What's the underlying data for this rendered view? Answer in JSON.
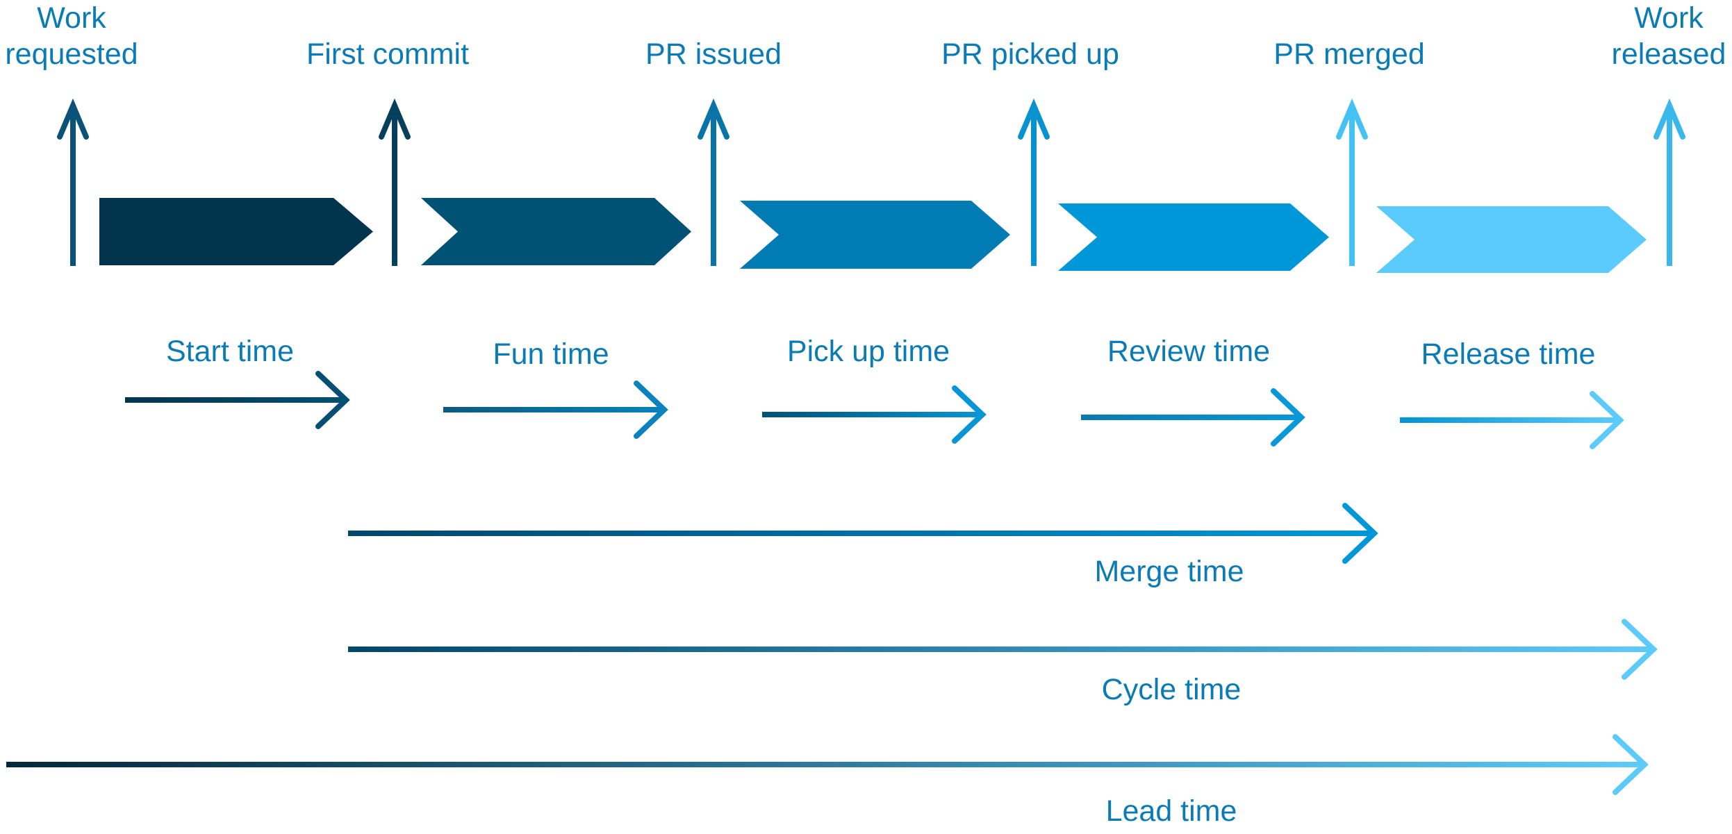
{
  "milestones": [
    {
      "label_lines": [
        "Work",
        "requested"
      ],
      "color": "#0a5277"
    },
    {
      "label_lines": [
        "First commit"
      ],
      "color": "#063f5c"
    },
    {
      "label_lines": [
        "PR issued"
      ],
      "color": "#0a73a8"
    },
    {
      "label_lines": [
        "PR picked up"
      ],
      "color": "#0892d0"
    },
    {
      "label_lines": [
        "PR merged"
      ],
      "color": "#45c2f5"
    },
    {
      "label_lines": [
        "Work",
        "released"
      ],
      "color": "#3ab8ec"
    }
  ],
  "phases": [
    {
      "label": "Start time",
      "color": "#02344e",
      "arrow_from": "#02344e",
      "arrow_to": "#064f72"
    },
    {
      "label": "Fun time",
      "color": "#005275",
      "arrow_from": "#0a5a80",
      "arrow_to": "#0a82bd"
    },
    {
      "label": "Pick up time",
      "color": "#007bb4",
      "arrow_from": "#005275",
      "arrow_to": "#0795d6"
    },
    {
      "label": "Review time",
      "color": "#0097d9",
      "arrow_from": "#0a7ab0",
      "arrow_to": "#0897d8"
    },
    {
      "label": "Release time",
      "color": "#5bcafd",
      "arrow_from": "#0094d6",
      "arrow_to": "#5ccbfc"
    }
  ],
  "spans": [
    {
      "label": "Merge time",
      "from": "First commit",
      "to": "PR merged",
      "color_from": "#02466a",
      "color_to": "#0097d9"
    },
    {
      "label": "Cycle time",
      "from": "First commit",
      "to": "Work released",
      "color_from": "#02466a",
      "color_to": "#5ccbfc"
    },
    {
      "label": "Lead time",
      "from": "Work requested",
      "to": "Work released",
      "color_from": "#02283d",
      "color_to": "#5ccbfc"
    }
  ],
  "text_color": "#0a7bb5"
}
